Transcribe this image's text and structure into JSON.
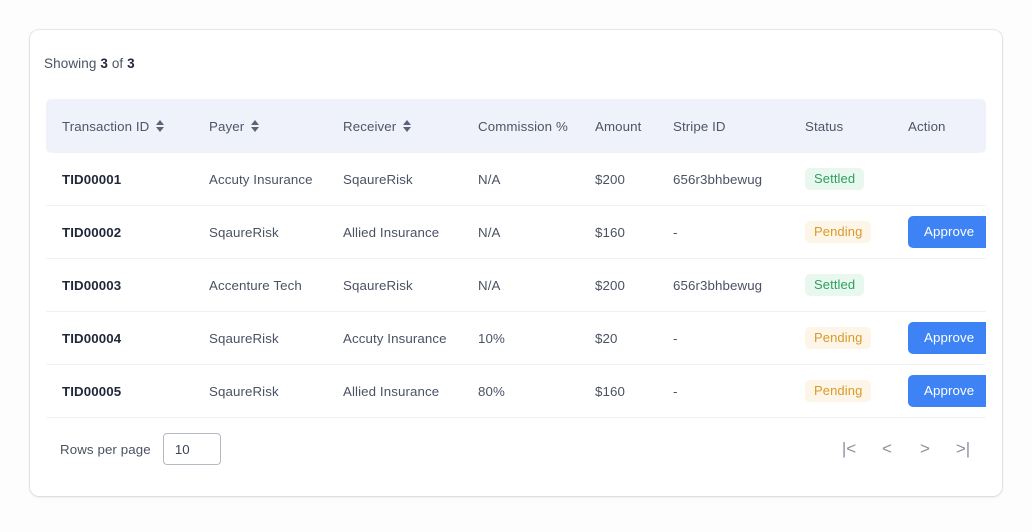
{
  "summary": {
    "prefix": "Showing",
    "count": "3",
    "middle": "of",
    "total": "3"
  },
  "table": {
    "columns": [
      {
        "label": "Transaction ID",
        "sortable": true
      },
      {
        "label": "Payer",
        "sortable": true
      },
      {
        "label": "Receiver",
        "sortable": true
      },
      {
        "label": "Commission %",
        "sortable": false
      },
      {
        "label": "Amount",
        "sortable": false
      },
      {
        "label": "Stripe ID",
        "sortable": false
      },
      {
        "label": "Status",
        "sortable": false
      },
      {
        "label": "Action",
        "sortable": false
      }
    ],
    "rows": [
      {
        "transaction_id": "TID00001",
        "payer": "Accuty Insurance",
        "receiver": "SqaureRisk",
        "commission": "N/A",
        "amount": "$200",
        "stripe_id": "656r3bhbewug",
        "status": "Settled",
        "status_kind": "settled",
        "action": ""
      },
      {
        "transaction_id": "TID00002",
        "payer": "SqaureRisk",
        "receiver": "Allied Insurance",
        "commission": "N/A",
        "amount": "$160",
        "stripe_id": "-",
        "status": "Pending",
        "status_kind": "pending",
        "action": "Approve"
      },
      {
        "transaction_id": "TID00003",
        "payer": "Accenture Tech",
        "receiver": "SqaureRisk",
        "commission": "N/A",
        "amount": "$200",
        "stripe_id": "656r3bhbewug",
        "status": "Settled",
        "status_kind": "settled",
        "action": ""
      },
      {
        "transaction_id": "TID00004",
        "payer": "SqaureRisk",
        "receiver": "Accuty Insurance",
        "commission": "10%",
        "amount": "$20",
        "stripe_id": "-",
        "status": "Pending",
        "status_kind": "pending",
        "action": "Approve"
      },
      {
        "transaction_id": "TID00005",
        "payer": "SqaureRisk",
        "receiver": "Allied Insurance",
        "commission": "80%",
        "amount": "$160",
        "stripe_id": "-",
        "status": "Pending",
        "status_kind": "pending",
        "action": "Approve"
      }
    ]
  },
  "footer": {
    "rows_per_page_label": "Rows per page",
    "rows_per_page_value": "10",
    "pagination": [
      {
        "name": "first-page-button",
        "glyph": "|<"
      },
      {
        "name": "previous-page-button",
        "glyph": "<"
      },
      {
        "name": "next-page-button",
        "glyph": ">"
      },
      {
        "name": "last-page-button",
        "glyph": ">|"
      }
    ]
  },
  "colors": {
    "accent": "#3d83f5",
    "settled_text": "#2f9e63",
    "settled_bg": "#e9f8ef",
    "pending_text": "#d99a28",
    "pending_bg": "#fdf5e7",
    "header_bg": "#eff2fa"
  }
}
